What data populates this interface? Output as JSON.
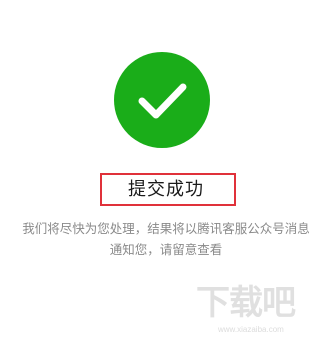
{
  "result": {
    "icon": "checkmark-icon",
    "icon_color": "#1aad19",
    "title": "提交成功",
    "highlight_color": "#e0313a",
    "message_line1": "我们将尽快为您处理，结果将以腾讯客服公众号消息",
    "message_line2": "通知您，请留意查看"
  },
  "watermark": {
    "text": "下载吧",
    "url": "www.xiazaiba.com"
  }
}
